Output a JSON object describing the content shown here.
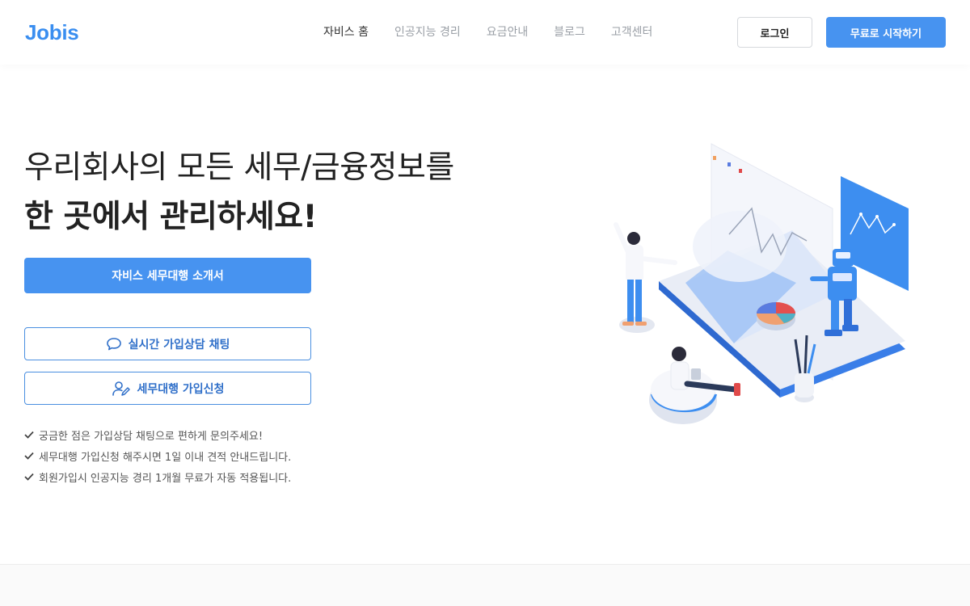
{
  "brand": {
    "logo": "Jobis",
    "accent": "#4793f0"
  },
  "nav": {
    "items": [
      {
        "label": "자비스 홈",
        "active": true
      },
      {
        "label": "인공지능 경리",
        "active": false
      },
      {
        "label": "요금안내",
        "active": false
      },
      {
        "label": "블로그",
        "active": false
      },
      {
        "label": "고객센터",
        "active": false
      }
    ],
    "login_label": "로그인",
    "start_label": "무료로 시작하기"
  },
  "hero": {
    "line1": "우리회사의 모든 세무/금융정보를",
    "line2": "한 곳에서 관리하세요!",
    "intro_button": "자비스 세무대행 소개서",
    "chat_button": "실시간 가입상담 채팅",
    "apply_button": "세무대행 가입신청",
    "chat_icon": "speech-bubble-icon",
    "apply_icon": "user-edit-icon"
  },
  "checklist": [
    "궁금한 점은 가입상담 채팅으로 편하게 문의주세요!",
    "세무대행 가입신청 해주시면 1일 이내 견적 안내드립니다.",
    "회원가입시 인공지능 경리 1개월 무료가 자동 적용됩니다."
  ]
}
